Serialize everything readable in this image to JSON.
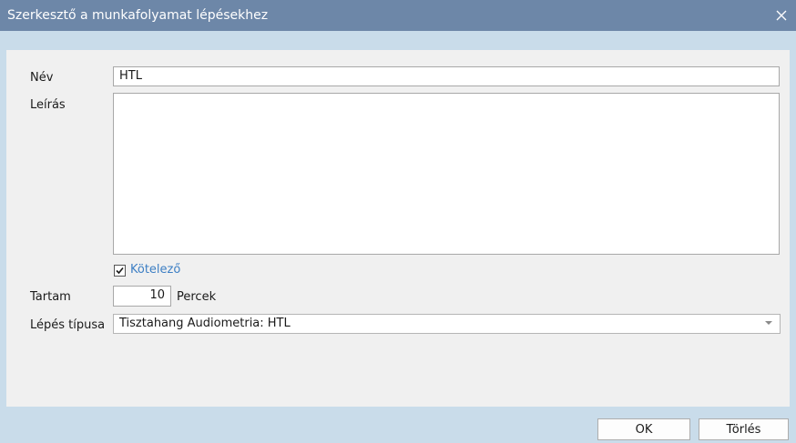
{
  "window": {
    "title": "Szerkesztő a munkafolyamat lépésekhez",
    "close_icon": "close-icon"
  },
  "form": {
    "name_label": "Név",
    "name_value": "HTL",
    "description_label": "Leírás",
    "description_value": "",
    "mandatory_checked": true,
    "mandatory_label": "Kötelező",
    "duration_label": "Tartam",
    "duration_value": "10",
    "duration_unit": "Percek",
    "step_type_label": "Lépés típusa",
    "step_type_value": "Tisztahang Audiometria: HTL"
  },
  "buttons": {
    "ok_label": "OK",
    "delete_label": "Törlés"
  },
  "colors": {
    "titlebar": "#6d87a8",
    "frame": "#c9dcea",
    "accent_link": "#3d7fc4"
  }
}
